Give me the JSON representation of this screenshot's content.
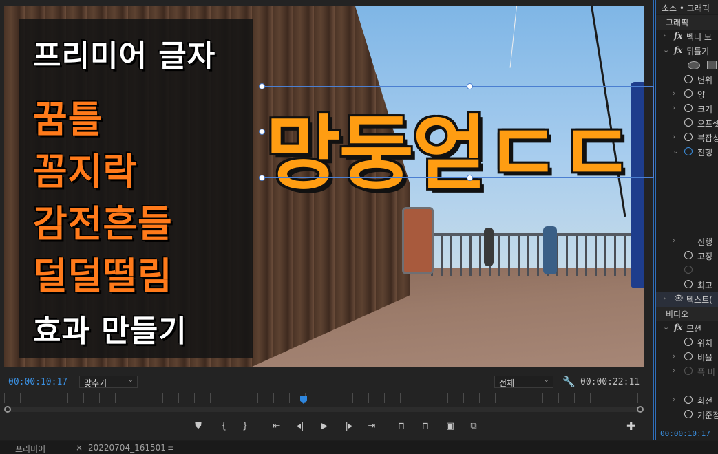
{
  "video_overlay": {
    "title_lines": [
      "프리미어 글자",
      "꿈틀",
      "꼼지락",
      "감전흔들",
      "덜덜떨림",
      "효과 만들기"
    ],
    "big_text": "망둥얻ㄷㄷ"
  },
  "monitor": {
    "timecode_current": "00:00:10:17",
    "fit_dropdown": "맞추기",
    "quality_dropdown": "전체",
    "timecode_duration": "00:00:22:11"
  },
  "transport_icons": [
    "marker-icon",
    "mark-in-icon",
    "mark-out-icon",
    "go-to-in-icon",
    "step-back-icon",
    "play-icon",
    "step-forward-icon",
    "go-to-out-icon",
    "insert-icon",
    "overwrite-icon",
    "export-frame-icon",
    "compare-icon"
  ],
  "transport_glyphs": [
    "⛊",
    "{",
    "}",
    "⇤",
    "◂|",
    "▶",
    "|▸",
    "⇥",
    "⊓",
    "⊓",
    "▣",
    "⧉"
  ],
  "right_panel": {
    "tabs": "소스 • 그래픽",
    "rows": [
      {
        "type": "section",
        "label": "그래픽"
      },
      {
        "type": "fx",
        "arrow": "›",
        "label": "벡터 모"
      },
      {
        "type": "fx",
        "arrow": "⌄",
        "label": "뒤틀기"
      },
      {
        "type": "shapes",
        "label": ""
      },
      {
        "type": "prop",
        "arrow": "",
        "label": "변위"
      },
      {
        "type": "prop",
        "arrow": "›",
        "label": "양"
      },
      {
        "type": "prop",
        "arrow": "›",
        "label": "크기"
      },
      {
        "type": "prop",
        "arrow": "",
        "label": "오프셋"
      },
      {
        "type": "prop",
        "arrow": "›",
        "label": "복잡성"
      },
      {
        "type": "prop-blue",
        "arrow": "⌄",
        "label": "진행"
      },
      {
        "type": "prop-plain",
        "arrow": "›",
        "label": "진행"
      },
      {
        "type": "prop",
        "arrow": "",
        "label": "고정"
      },
      {
        "type": "prop-dim",
        "arrow": "",
        "label": ""
      },
      {
        "type": "prop",
        "arrow": "",
        "label": "최고"
      },
      {
        "type": "eye",
        "arrow": "›",
        "label": "텍스트("
      },
      {
        "type": "section",
        "label": "비디오"
      },
      {
        "type": "fx",
        "arrow": "⌄",
        "label": "모션"
      },
      {
        "type": "prop",
        "arrow": "",
        "label": "위치"
      },
      {
        "type": "prop",
        "arrow": "›",
        "label": "비율"
      },
      {
        "type": "prop-dim",
        "arrow": "›",
        "label": "폭 비"
      },
      {
        "type": "prop",
        "arrow": "›",
        "label": "회전"
      },
      {
        "type": "prop",
        "arrow": "",
        "label": "기준점"
      }
    ],
    "timecode": "00:00:10:17"
  },
  "bottom_bar": {
    "tab1": "프리미어",
    "close": "×",
    "tab2": "20220704_161501",
    "menu": "≡"
  }
}
